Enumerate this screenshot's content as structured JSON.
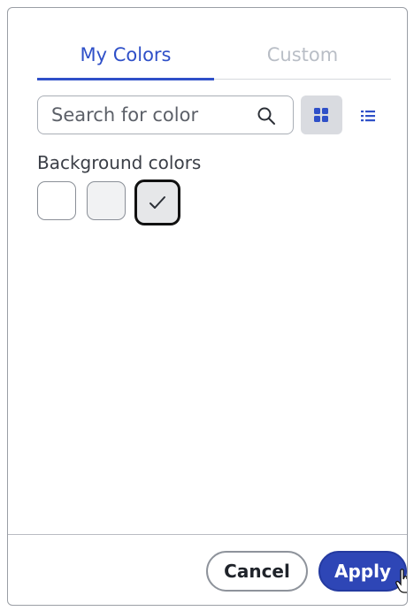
{
  "tabs": [
    {
      "label": "My Colors",
      "active": true
    },
    {
      "label": "Custom",
      "active": false
    }
  ],
  "search": {
    "placeholder": "Search for color",
    "value": ""
  },
  "view": {
    "selected": "grid"
  },
  "section": {
    "label": "Background colors"
  },
  "swatches": [
    {
      "color": "#ffffff",
      "selected": false
    },
    {
      "color": "#f1f2f3",
      "selected": false
    },
    {
      "color": "#e6e7e9",
      "selected": true
    }
  ],
  "footer": {
    "cancel_label": "Cancel",
    "apply_label": "Apply"
  },
  "colors": {
    "accent": "#2f50c8",
    "apply_bg": "#2e46b6"
  }
}
